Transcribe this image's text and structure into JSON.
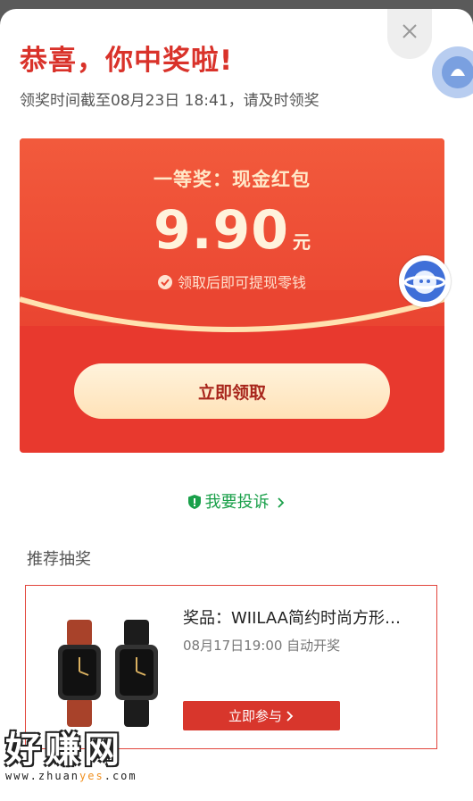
{
  "header": {
    "title": "恭喜，你中奖啦!",
    "deadline": "领奖时间截至08月23日 18:41，请及时领奖"
  },
  "prize": {
    "name": "一等奖：现金红包",
    "amount": "9.90",
    "unit": "元",
    "hint": "领取后即可提现零钱",
    "claim_label": "立即领取"
  },
  "complain": {
    "label": "我要投诉"
  },
  "recommend": {
    "section_title": "推荐抽奖",
    "item": {
      "title": "奖品：WIILAA简约时尚方形…",
      "time": "08月17日19:00 自动开奖",
      "join_label": "立即参与"
    }
  },
  "watermark": {
    "main": "好赚网",
    "sub_prefix": "www.zhuan",
    "sub_highlight": "yes",
    "sub_suffix": ".com"
  },
  "colors": {
    "accent": "#d9322a",
    "card": "#e8392e",
    "green": "#1aa04a"
  },
  "icons": [
    "close-icon",
    "avatar-bubble-icon",
    "check-icon",
    "shield-icon",
    "chevron-right-icon"
  ]
}
